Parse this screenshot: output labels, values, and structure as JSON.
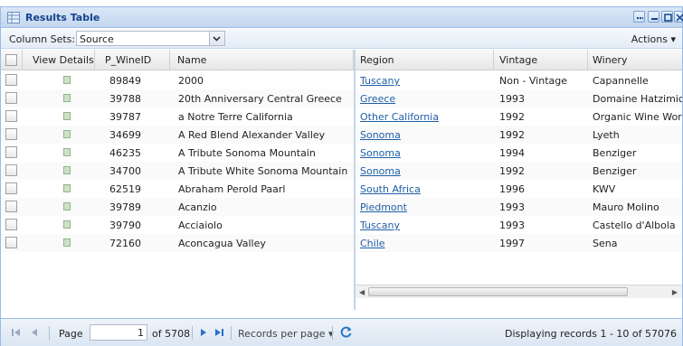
{
  "window": {
    "title": "Results Table",
    "column_sets_label": "Column Sets:",
    "column_set_value": "Source",
    "actions_label": "Actions ▾"
  },
  "columns_left": [
    "View Details",
    "P_WineID",
    "Name"
  ],
  "columns_right": [
    "Region",
    "Vintage",
    "Winery"
  ],
  "rows": [
    {
      "id": "89849",
      "name": "2000",
      "region": "Tuscany",
      "vintage": "Non - Vintage",
      "winery": "Capannelle"
    },
    {
      "id": "39788",
      "name": "20th Anniversary Central Greece",
      "region": "Greece",
      "vintage": "1993",
      "winery": "Domaine Hatzimichalis"
    },
    {
      "id": "39787",
      "name": "a Notre Terre California",
      "region": "Other California",
      "vintage": "1992",
      "winery": "Organic Wine Works"
    },
    {
      "id": "34699",
      "name": "A Red Blend Alexander Valley",
      "region": "Sonoma",
      "vintage": "1992",
      "winery": "Lyeth"
    },
    {
      "id": "46235",
      "name": "A Tribute Sonoma Mountain",
      "region": "Sonoma",
      "vintage": "1994",
      "winery": "Benziger"
    },
    {
      "id": "34700",
      "name": "A Tribute White Sonoma Mountain",
      "region": "Sonoma",
      "vintage": "1992",
      "winery": "Benziger"
    },
    {
      "id": "62519",
      "name": "Abraham Perold Paarl",
      "region": "South Africa",
      "vintage": "1996",
      "winery": "KWV"
    },
    {
      "id": "39789",
      "name": "Acanzio",
      "region": "Piedmont",
      "vintage": "1993",
      "winery": "Mauro Molino"
    },
    {
      "id": "39790",
      "name": "Acciaiolo",
      "region": "Tuscany",
      "vintage": "1993",
      "winery": "Castello d'Albola"
    },
    {
      "id": "72160",
      "name": "Aconcagua Valley",
      "region": "Chile",
      "vintage": "1997",
      "winery": "Sena"
    }
  ],
  "pager": {
    "page_label": "Page",
    "page_value": "1",
    "of_text": "of 5708",
    "records_per_page": "Records per page ▾",
    "display_text": "Displaying records 1 - 10 of 57076"
  },
  "colors": {
    "title_blue": "#15428b",
    "link_blue": "#1f5fa8",
    "border": "#99bbe8"
  }
}
